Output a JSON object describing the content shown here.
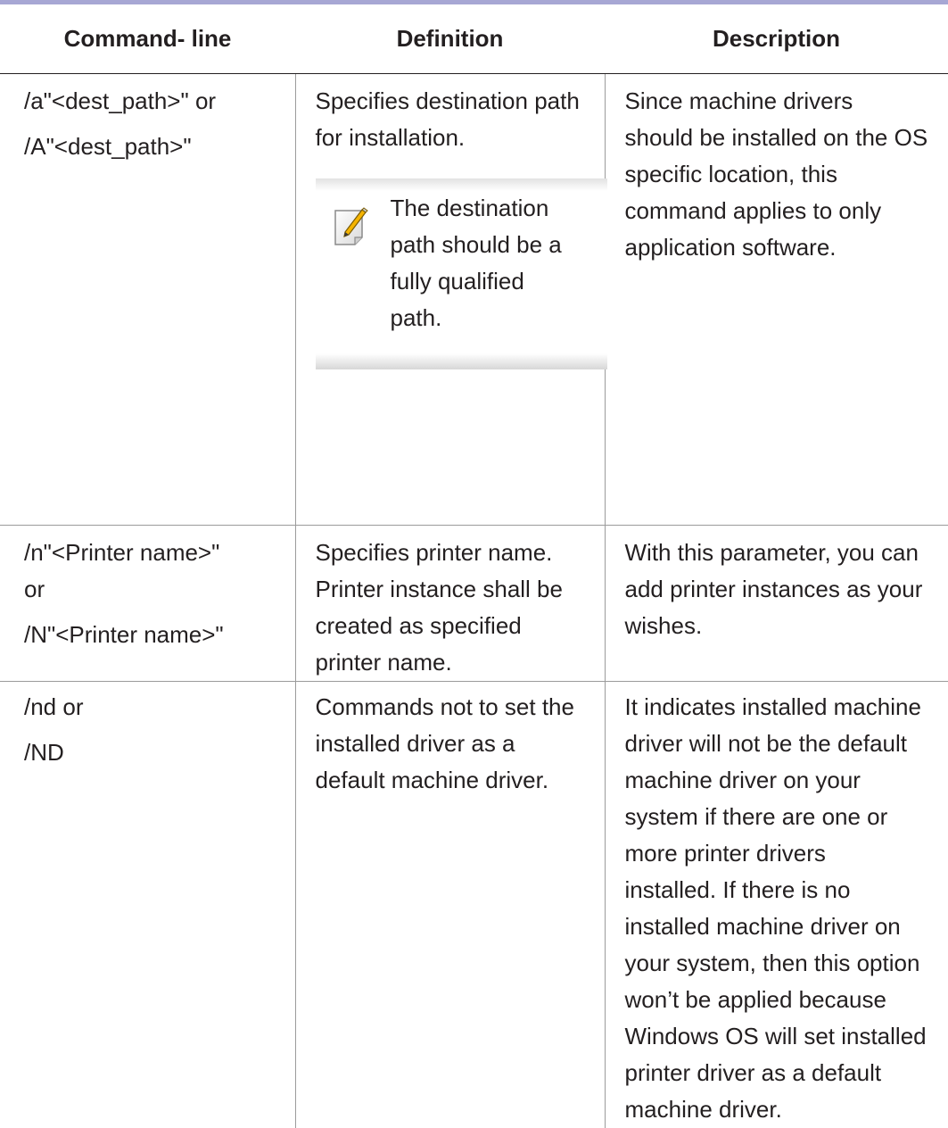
{
  "table": {
    "headers": [
      "Command- line",
      "Definition",
      "Description"
    ],
    "rows": [
      {
        "command_lines": [
          "/a\"<dest_path>\" or",
          "/A\"<dest_path>\""
        ],
        "definition_lines": [
          "Specifies destination path",
          "for installation."
        ],
        "note": {
          "icon": "note-pencil-icon",
          "lines": [
            "The destination",
            "path should be a",
            "fully qualified",
            "path."
          ]
        },
        "description_lines": [
          "Since machine drivers",
          "should be installed on the OS",
          "specific location, this",
          "command applies to only",
          "application software."
        ]
      },
      {
        "command_lines": [
          "/n\"<Printer name>\"",
          "or",
          "/N\"<Printer name>\""
        ],
        "definition_lines": [
          "Specifies printer name.",
          "Printer instance shall be",
          "created as specified",
          "printer name."
        ],
        "description_lines": [
          "With this parameter, you can",
          "add printer instances as your",
          "wishes."
        ]
      },
      {
        "command_lines": [
          "/nd or",
          "/ND"
        ],
        "definition_lines": [
          "Commands not to set the",
          "installed driver as a",
          "default machine driver."
        ],
        "description_lines": [
          "It indicates installed machine",
          "driver will not be the default",
          "machine driver on your",
          "system if there are one or",
          "more printer drivers",
          "installed. If there is no",
          "installed machine driver on",
          "your system, then this option",
          "won’t be applied because",
          "Windows OS will set installed",
          "printer driver as a default",
          "machine driver."
        ]
      }
    ]
  },
  "colors": {
    "top_rule": "#a7a7d4",
    "text": "#231f20",
    "grid": "#9b9b9b"
  }
}
